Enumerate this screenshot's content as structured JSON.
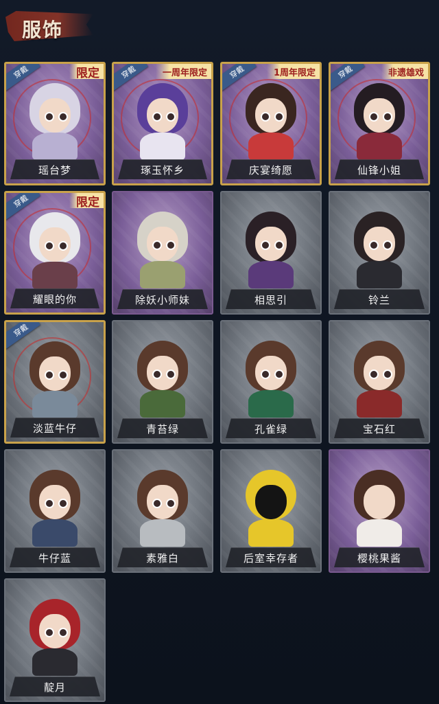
{
  "header": {
    "title": "服饰"
  },
  "badge_text": "穿戴",
  "colors": {
    "gold_border": "#c9a24a",
    "wear_tag": "#3a5a8a",
    "limit_text": "#9b1d1d",
    "name_text": "#f3f3f3",
    "background": "#0e1420"
  },
  "costumes": [
    {
      "name": "瑶台梦",
      "worn": true,
      "tag": "限定"
    },
    {
      "name": "琢玉怀乡",
      "worn": true,
      "tag": "一周年限定"
    },
    {
      "name": "庆宴绮愿",
      "worn": true,
      "tag": "1周年限定"
    },
    {
      "name": "仙锋小姐",
      "worn": true,
      "tag": "非遗雄戏"
    },
    {
      "name": "耀眼的你",
      "worn": true,
      "tag": "限定"
    },
    {
      "name": "除妖小师妹",
      "worn": false,
      "tag": ""
    },
    {
      "name": "相思引",
      "worn": false,
      "tag": ""
    },
    {
      "name": "铃兰",
      "worn": false,
      "tag": ""
    },
    {
      "name": "淡蓝牛仔",
      "worn": true,
      "tag": ""
    },
    {
      "name": "青苔绿",
      "worn": false,
      "tag": ""
    },
    {
      "name": "孔雀绿",
      "worn": false,
      "tag": ""
    },
    {
      "name": "宝石红",
      "worn": false,
      "tag": ""
    },
    {
      "name": "牛仔蓝",
      "worn": false,
      "tag": ""
    },
    {
      "name": "素雅白",
      "worn": false,
      "tag": ""
    },
    {
      "name": "后室幸存者",
      "worn": false,
      "tag": ""
    },
    {
      "name": "樱桃果酱",
      "worn": false,
      "tag": ""
    },
    {
      "name": "靛月",
      "worn": false,
      "tag": ""
    }
  ]
}
